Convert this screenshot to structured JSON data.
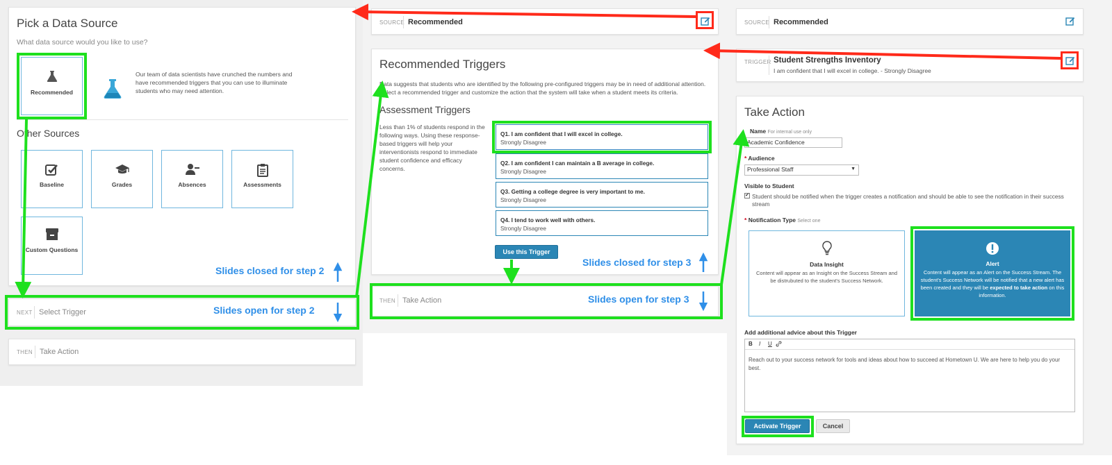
{
  "step1": {
    "title": "Pick a Data Source",
    "question": "What data source would you like to use?",
    "recommended_label": "Recommended",
    "recommended_description": "Our team of data scientists have crunched the numbers and have recommended triggers that you can use to illuminate students who may need attention.",
    "other_sources_heading": "Other Sources",
    "sources": [
      {
        "label": "Baseline",
        "icon": "check-square-icon"
      },
      {
        "label": "Grades",
        "icon": "graduation-cap-icon"
      },
      {
        "label": "Absences",
        "icon": "user-minus-icon"
      },
      {
        "label": "Assessments",
        "icon": "clipboard-icon"
      },
      {
        "label": "Custom Questions",
        "icon": "archive-icon"
      }
    ],
    "next_bar": {
      "label": "NEXT",
      "value": "Select Trigger"
    },
    "then_bar": {
      "label": "THEN",
      "value": "Take Action"
    }
  },
  "step2": {
    "source_bar": {
      "label": "SOURCE",
      "value": "Recommended"
    },
    "title": "Recommended Triggers",
    "intro": "Data suggests that students who are identified by the following pre-configured triggers may be in need of additional attention. Select a recommended trigger and customize the action that the system will take when a student meets its criteria.",
    "section_title": "Assessment Triggers",
    "section_description": "Less than 1% of students respond in the following ways. Using these response-based triggers will help your interventionists respond to immediate student confidence and efficacy concerns.",
    "triggers": [
      {
        "title": "Q1. I am confident that I will excel in college.",
        "answer": "Strongly Disagree"
      },
      {
        "title": "Q2. I am confident I can maintain a B average in college.",
        "answer": "Strongly Disagree"
      },
      {
        "title": "Q3. Getting a college degree is very important to me.",
        "answer": "Strongly Disagree"
      },
      {
        "title": "Q4. I tend to work well with others.",
        "answer": "Strongly Disagree"
      }
    ],
    "use_button": "Use this Trigger",
    "then_bar": {
      "label": "THEN",
      "value": "Take Action"
    }
  },
  "step3": {
    "source_bar": {
      "label": "SOURCE",
      "value": "Recommended"
    },
    "trigger_bar": {
      "label": "TRIGGER",
      "value": "Student Strengths Inventory",
      "detail": "I am confident that I will excel in college. - Strongly Disagree"
    },
    "title": "Take Action",
    "name_label": "Name",
    "name_hint": "For internal use only",
    "name_value": "Academic Confidence",
    "audience_label": "Audience",
    "audience_value": "Professional Staff",
    "visible_label": "Visible to Student",
    "visible_text": "Student should be notified when the trigger creates a notification and should be able to see the notification in their success stream",
    "notification_label": "Notification Type",
    "notification_hint": "Select one",
    "insight_title": "Data Insight",
    "insight_desc": "Content will appear as an Insight on the Success Stream and be distrubuted to the student's Success Network.",
    "alert_title": "Alert",
    "alert_desc_a": "Content will appear as an Alert on the Success Stream. The student's Success Network will be notified that a new alert has been created and they will be ",
    "alert_desc_bold": "expected to take action",
    "alert_desc_b": " on this information.",
    "advice_label": "Add additional advice about this Trigger",
    "toolbar": [
      "B",
      "I",
      "U",
      "link-icon"
    ],
    "advice_text": "Reach out to your success network for tools and ideas about how to succeed at Hometown U. We are here to help you do your best.",
    "activate_button": "Activate Trigger",
    "cancel_button": "Cancel"
  },
  "annotations": {
    "closed_step2": "Slides closed for step 2",
    "open_step2": "Slides open for step 2",
    "closed_step3": "Slides closed for step 3",
    "open_step3": "Slides open for step 3"
  },
  "colors": {
    "accent_blue": "#2b86b5",
    "tile_border": "#6fb6de",
    "highlight_green": "#1ee01e",
    "highlight_red": "#ff2a1a",
    "annotation_blue": "#2f8fe8"
  }
}
